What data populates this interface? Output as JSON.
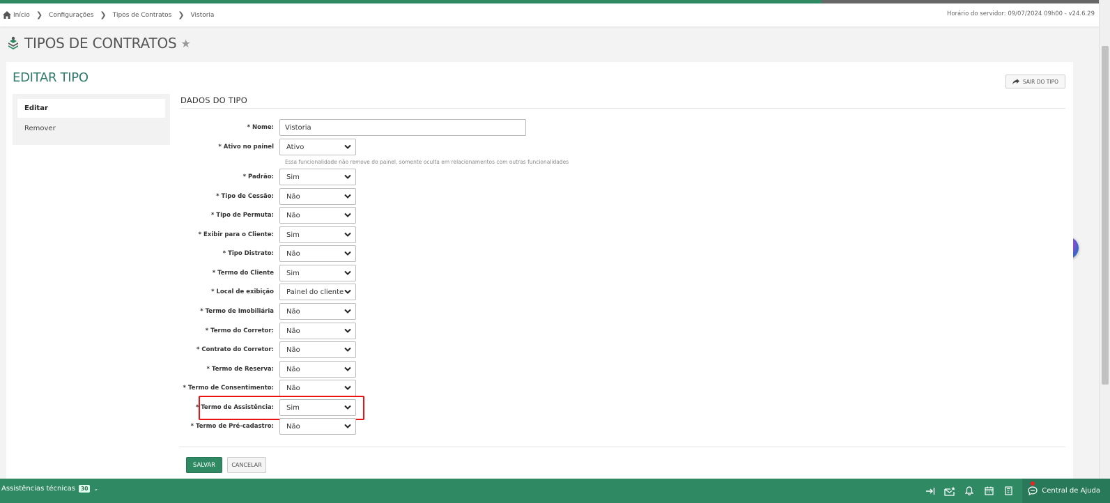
{
  "breadcrumb": {
    "home": "Início",
    "items": [
      "Configurações",
      "Tipos de Contratos",
      "Vistoria"
    ],
    "separator": "❯"
  },
  "server_time": "Horário do servidor: 09/07/2024 09h00 - v24.6.29",
  "page": {
    "title": "TIPOS DE CONTRATOS",
    "star_icon": "star-icon"
  },
  "card": {
    "title": "EDITAR TIPO",
    "exit_button": "SAIR DO TIPO"
  },
  "sidemenu": {
    "items": [
      {
        "label": "Editar",
        "active": true
      },
      {
        "label": "Remover",
        "active": false
      }
    ]
  },
  "form": {
    "section_title": "DADOS DO TIPO",
    "nome_label": "* Nome:",
    "nome_value": "Vistoria",
    "ativo_hint": "Essa funcionalidade não remove do painel, somente oculta em relacionamentos com outras funcionalidades",
    "fields": [
      {
        "label": "* Ativo no painel",
        "value": "Ativo"
      },
      {
        "label": "* Padrão:",
        "value": "Sim"
      },
      {
        "label": "* Tipo de Cessão:",
        "value": "Não"
      },
      {
        "label": "* Tipo de Permuta:",
        "value": "Não"
      },
      {
        "label": "* Exibir para o Cliente:",
        "value": "Sim"
      },
      {
        "label": "* Tipo Distrato:",
        "value": "Não"
      },
      {
        "label": "* Termo do Cliente",
        "value": "Sim"
      },
      {
        "label": "* Local de exibição",
        "value": "Painel do cliente"
      },
      {
        "label": "* Termo de Imobiliária",
        "value": "Não"
      },
      {
        "label": "* Termo do Corretor:",
        "value": "Não"
      },
      {
        "label": "* Contrato do Corretor:",
        "value": "Não"
      },
      {
        "label": "* Termo de Reserva:",
        "value": "Não"
      },
      {
        "label": "* Termo de Consentimento:",
        "value": "Não"
      },
      {
        "label": "* Termo de Assistência:",
        "value": "Sim"
      },
      {
        "label": "* Termo de Pré-cadastro:",
        "value": "Não"
      }
    ],
    "save_label": "SALVAR",
    "cancel_label": "CANCELAR"
  },
  "statusbar": {
    "left_label": "Assistências técnicas",
    "left_count": "30",
    "help_label": "Central de Ajuda"
  },
  "colors": {
    "brand_green": "#2f8a64",
    "title_teal": "#2f7a6a",
    "highlight_red": "#ee1111"
  }
}
